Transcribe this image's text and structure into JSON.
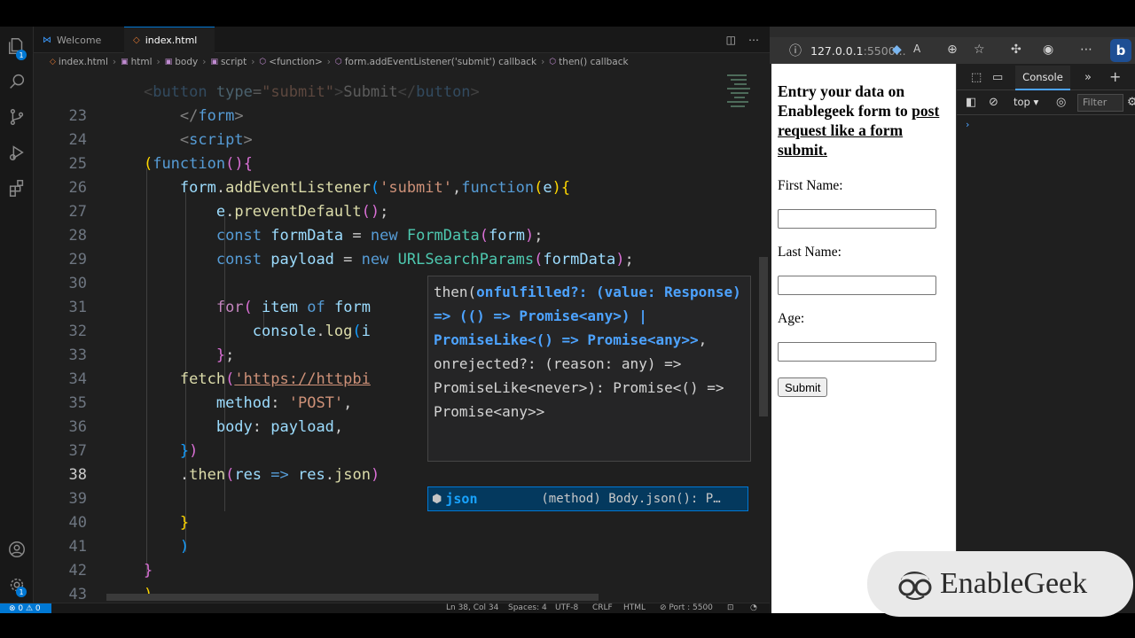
{
  "editor": {
    "tabs": [
      {
        "label": "Welcome"
      },
      {
        "label": "index.html"
      }
    ],
    "breadcrumb": [
      "index.html",
      "html",
      "body",
      "script",
      "<function>",
      "form.addEventListener('submit') callback",
      "then() callback"
    ],
    "hover_signature": {
      "pre": "then(",
      "hl1": "onfulfilled?: (value: Response) => (() => Promise<any>) | PromiseLike<() => Promise<any>>",
      "post": ", onrejected?: (reason: any) => PromiseLike<never>): Promise<() => Promise<any>>"
    },
    "suggestion": {
      "label": "json",
      "detail": "(method) Body.json(): P…"
    },
    "status": {
      "problems": "0 ⚠ 0",
      "position": "Ln 38, Col 34",
      "spaces": "Spaces: 4",
      "encoding": "UTF-8",
      "eol": "CRLF",
      "language": "HTML",
      "port": "Port : 5500"
    }
  },
  "browser": {
    "url_host": "127.0.0.1",
    "url_port": ":5500...",
    "page": {
      "heading_line1": "Entry your data on Enablegeek form to",
      "heading_line2": "post request like a form submit.",
      "first_name_label": "First Name:",
      "last_name_label": "Last Name:",
      "age_label": "Age:",
      "submit_label": "Submit"
    },
    "devtools": {
      "tab": "Console",
      "context": "top",
      "filter_placeholder": "Filter"
    }
  },
  "logo": {
    "text": "EnableGeek"
  },
  "colors": {
    "accent": "#0078d4",
    "editor_bg": "#1f1f1f",
    "hover_highlight": "#4da3ff"
  }
}
